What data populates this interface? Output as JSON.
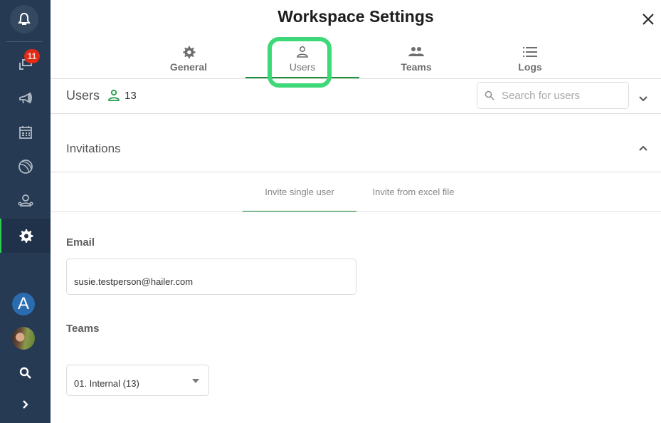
{
  "sidebar": {
    "notification_badge": "11",
    "items": [
      {
        "name": "notifications",
        "icon": "bell-icon"
      },
      {
        "name": "messages",
        "icon": "chat-icon",
        "badge": "11"
      },
      {
        "name": "announcements",
        "icon": "megaphone-icon"
      },
      {
        "name": "calendar",
        "icon": "calendar-icon"
      },
      {
        "name": "activities",
        "icon": "ball-icon"
      },
      {
        "name": "contacts",
        "icon": "people-icon"
      },
      {
        "name": "settings",
        "icon": "gear-icon",
        "active": true
      }
    ],
    "workspace_avatar_letter": "A",
    "bottom": [
      "workspace-avatar",
      "user-avatar",
      "search-icon",
      "expand-chevron-icon"
    ]
  },
  "header": {
    "title": "Workspace Settings",
    "close_icon": "close-icon"
  },
  "tabs": [
    {
      "label": "General",
      "icon": "gear-icon",
      "active": false
    },
    {
      "label": "Users",
      "icon": "person-icon",
      "active": true
    },
    {
      "label": "Teams",
      "icon": "group-icon",
      "active": false
    },
    {
      "label": "Logs",
      "icon": "list-icon",
      "active": false
    }
  ],
  "users_bar": {
    "label": "Users",
    "count": "13",
    "search_placeholder": "Search for users",
    "search_value": ""
  },
  "invitations": {
    "title": "Invitations",
    "subtabs": [
      {
        "label": "Invite single user",
        "active": true
      },
      {
        "label": "Invite from excel file",
        "active": false
      }
    ],
    "email_label": "Email",
    "email_value": "susie.testperson@hailer.com",
    "teams_label": "Teams",
    "teams_selected": "01. Internal (13)"
  },
  "colors": {
    "sidebar_bg": "#263a54",
    "accent_green": "#1f8f3a",
    "highlight": "#3dd878",
    "badge_red": "#e02b15",
    "avatar_blue": "#2b6cb0"
  }
}
